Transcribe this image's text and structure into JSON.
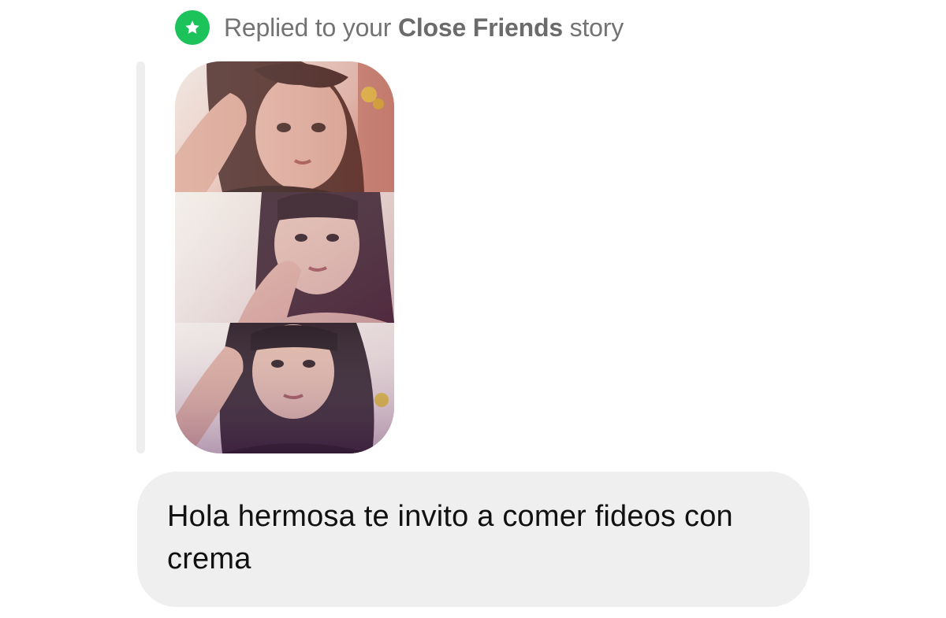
{
  "reply_header": {
    "prefix": "Replied to your ",
    "emphasis": "Close Friends",
    "suffix": " story",
    "badge_icon": "star-icon",
    "badge_color": "#1bc35a"
  },
  "story_preview": {
    "panels": [
      {
        "name": "story-photo-top"
      },
      {
        "name": "story-photo-middle"
      },
      {
        "name": "story-photo-bottom"
      }
    ]
  },
  "message": {
    "text": "Hola hermosa te invito a comer fideos con crema",
    "bubble_color": "#efefef"
  }
}
